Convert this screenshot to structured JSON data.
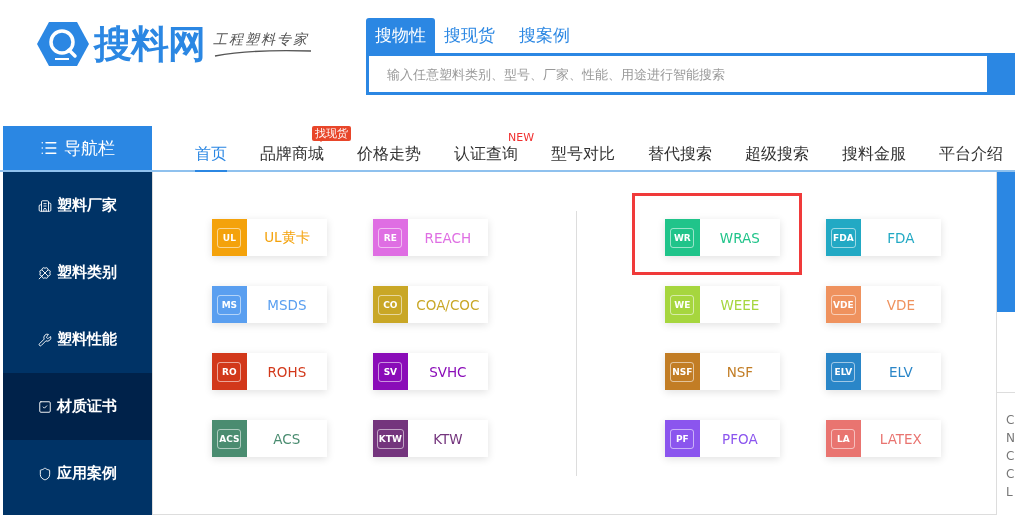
{
  "logo": {
    "name": "搜料网",
    "slogan": "工程塑料专家"
  },
  "search": {
    "tabs": [
      {
        "label": "搜物性",
        "selected": true
      },
      {
        "label": "搜现货",
        "selected": false
      },
      {
        "label": "搜案例",
        "selected": false
      }
    ],
    "placeholder": "输入任意塑料类别、型号、厂家、性能、用途进行智能搜索"
  },
  "nav": {
    "menu_label": "导航栏",
    "items": [
      {
        "label": "首页",
        "selected": true
      },
      {
        "label": "品牌商城",
        "selected": false,
        "badge": {
          "text": "找现货",
          "kind": "tag"
        }
      },
      {
        "label": "价格走势",
        "selected": false
      },
      {
        "label": "认证查询",
        "selected": false,
        "badge": {
          "text": "NEW",
          "kind": "text"
        }
      },
      {
        "label": "型号对比",
        "selected": false
      },
      {
        "label": "替代搜索",
        "selected": false
      },
      {
        "label": "超级搜索",
        "selected": false
      },
      {
        "label": "搜料金服",
        "selected": false
      },
      {
        "label": "平台介绍",
        "selected": false
      }
    ]
  },
  "sidebar": {
    "items": [
      {
        "label": "塑料厂家",
        "kind": "factory",
        "selected": false
      },
      {
        "label": "塑料类别",
        "kind": "category",
        "selected": false
      },
      {
        "label": "塑料性能",
        "kind": "performance",
        "selected": false
      },
      {
        "label": "材质证书",
        "kind": "certificate",
        "selected": true
      },
      {
        "label": "应用案例",
        "kind": "case",
        "selected": false
      }
    ]
  },
  "certificate_groups": [
    {
      "items": [
        {
          "code": "UL",
          "label": "UL黄卡",
          "color": "#f4a20b",
          "highlighted": false
        },
        {
          "code": "RE",
          "label": "REACH",
          "color": "#df6ee3",
          "highlighted": false
        },
        {
          "code": "MS",
          "label": "MSDS",
          "color": "#5a9ff0",
          "highlighted": false
        },
        {
          "code": "CO",
          "label": "COA/COC",
          "color": "#c9a726",
          "highlighted": false
        },
        {
          "code": "RO",
          "label": "ROHS",
          "color": "#d2381a",
          "highlighted": false
        },
        {
          "code": "SV",
          "label": "SVHC",
          "color": "#8a0cb8",
          "highlighted": false
        },
        {
          "code": "ACS",
          "label": "ACS",
          "color": "#4a8c70",
          "highlighted": false
        },
        {
          "code": "KTW",
          "label": "KTW",
          "color": "#74357d",
          "highlighted": false
        }
      ]
    },
    {
      "items": [
        {
          "code": "WR",
          "label": "WRAS",
          "color": "#20c48a",
          "highlighted": true
        },
        {
          "code": "FDA",
          "label": "FDA",
          "color": "#22a9c4",
          "highlighted": false
        },
        {
          "code": "WE",
          "label": "WEEE",
          "color": "#a6d63e",
          "highlighted": false
        },
        {
          "code": "VDE",
          "label": "VDE",
          "color": "#ef925e",
          "highlighted": false
        },
        {
          "code": "NSF",
          "label": "NSF",
          "color": "#c27d25",
          "highlighted": false
        },
        {
          "code": "ELV",
          "label": "ELV",
          "color": "#2a86c8",
          "highlighted": false
        },
        {
          "code": "PF",
          "label": "PFOA",
          "color": "#8b55ee",
          "highlighted": false
        },
        {
          "code": "LA",
          "label": "LATEX",
          "color": "#e97470",
          "highlighted": false
        }
      ]
    }
  ],
  "side_panel": {
    "lines": [
      "C",
      "N",
      "C",
      "C",
      "L"
    ]
  }
}
